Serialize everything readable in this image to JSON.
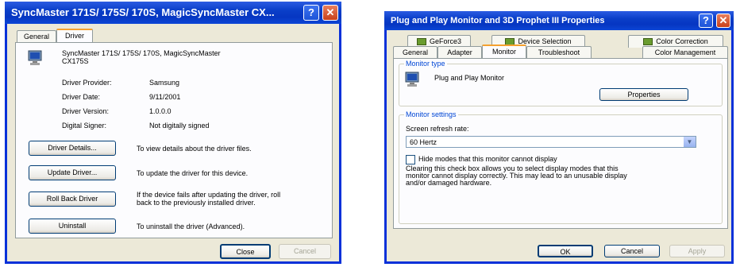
{
  "left_dialog": {
    "title": "SyncMaster 171S/ 175S/ 170S, MagicSyncMaster CX...",
    "help_glyph": "?",
    "close_glyph": "✕",
    "tabs": [
      "General",
      "Driver"
    ],
    "device_name_line1": "SyncMaster 171S/ 175S/ 170S, MagicSyncMaster",
    "device_name_line2": "CX175S",
    "props": [
      {
        "label": "Driver Provider:",
        "value": "Samsung"
      },
      {
        "label": "Driver Date:",
        "value": "9/11/2001"
      },
      {
        "label": "Driver Version:",
        "value": "1.0.0.0"
      },
      {
        "label": "Digital Signer:",
        "value": "Not digitally signed"
      }
    ],
    "actions": [
      {
        "button": "Driver Details...",
        "desc1": "To view details about the driver files.",
        "desc2": ""
      },
      {
        "button": "Update Driver...",
        "desc1": "To update the driver for this device.",
        "desc2": ""
      },
      {
        "button": "Roll Back Driver",
        "desc1": "If the device fails after updating the driver, roll",
        "desc2": "back to the previously installed driver."
      },
      {
        "button": "Uninstall",
        "desc1": "To uninstall the driver (Advanced).",
        "desc2": ""
      }
    ],
    "close_label": "Close",
    "cancel_label": "Cancel"
  },
  "right_dialog": {
    "title": "Plug and Play Monitor and 3D Prophet III Properties",
    "help_glyph": "?",
    "close_glyph": "✕",
    "tabs_row1": [
      "GeForce3",
      "Device Selection",
      "Color Correction"
    ],
    "tabs_row2": [
      "General",
      "Adapter",
      "Monitor",
      "Troubleshoot",
      "Color Management"
    ],
    "monitor_type_label": "Monitor type",
    "monitor_name": "Plug and Play Monitor",
    "properties_label": "Properties",
    "monitor_settings_label": "Monitor settings",
    "refresh_label": "Screen refresh rate:",
    "refresh_value": "60 Hertz",
    "checkbox_label": "Hide modes that this monitor cannot display",
    "desc_lines": [
      "Clearing this check box allows you to select display modes that this",
      "monitor cannot display correctly. This may lead to an unusable display",
      "and/or damaged hardware."
    ],
    "ok_label": "OK",
    "cancel_label": "Cancel",
    "apply_label": "Apply"
  }
}
